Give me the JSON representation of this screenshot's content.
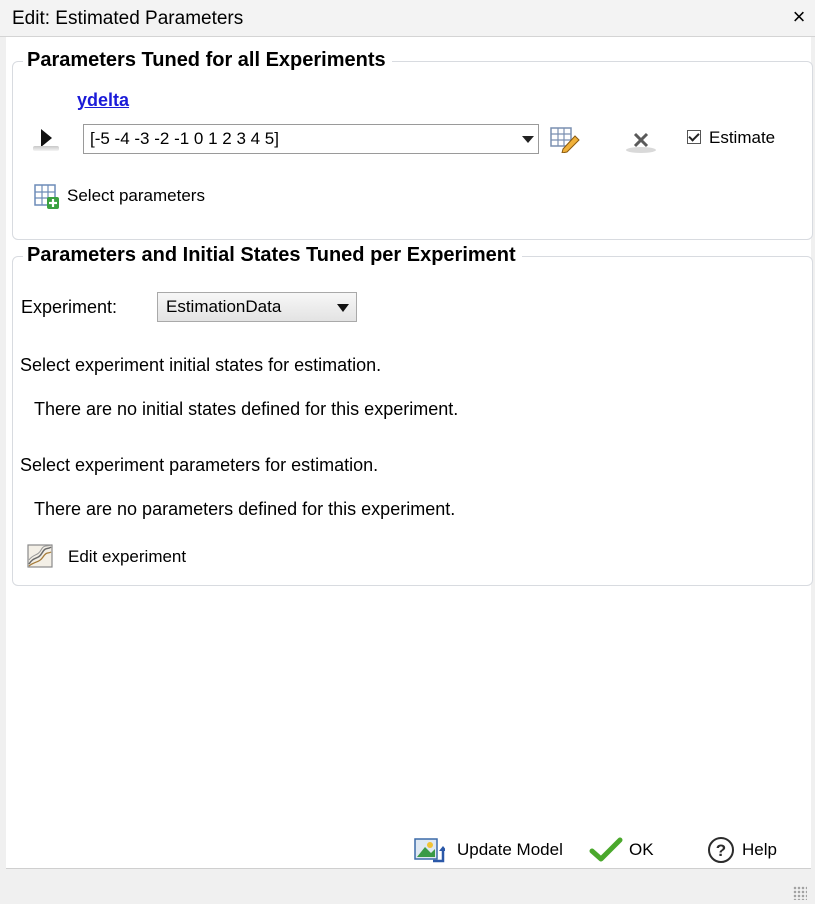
{
  "window": {
    "title": "Edit: Estimated Parameters",
    "close_glyph": "×"
  },
  "global_group": {
    "title": "Parameters Tuned for all Experiments",
    "parameter_name": "ydelta",
    "parameter_value": "[-5 -4 -3 -2 -1 0 1 2 3 4 5]",
    "estimate_label": "Estimate",
    "estimate_checked": true,
    "select_parameters_label": "Select parameters"
  },
  "experiment_group": {
    "title": "Parameters and Initial States Tuned per Experiment",
    "experiment_label": "Experiment:",
    "experiment_value": "EstimationData",
    "states_heading": "Select experiment initial states for estimation.",
    "states_message": "There are no initial states defined for this experiment.",
    "params_heading": "Select experiment parameters for estimation.",
    "params_message": "There are no parameters defined for this experiment.",
    "edit_experiment_label": "Edit experiment"
  },
  "footer": {
    "update_model_label": "Update Model",
    "ok_label": "OK",
    "help_label": "Help"
  },
  "icons": {
    "expand": "triangle-right",
    "edit": "table-pencil",
    "delete": "x-mark",
    "select": "table-plus",
    "edit_experiment": "signal-chart",
    "update_model": "model-update",
    "ok": "checkmark",
    "help": "question-circle"
  }
}
